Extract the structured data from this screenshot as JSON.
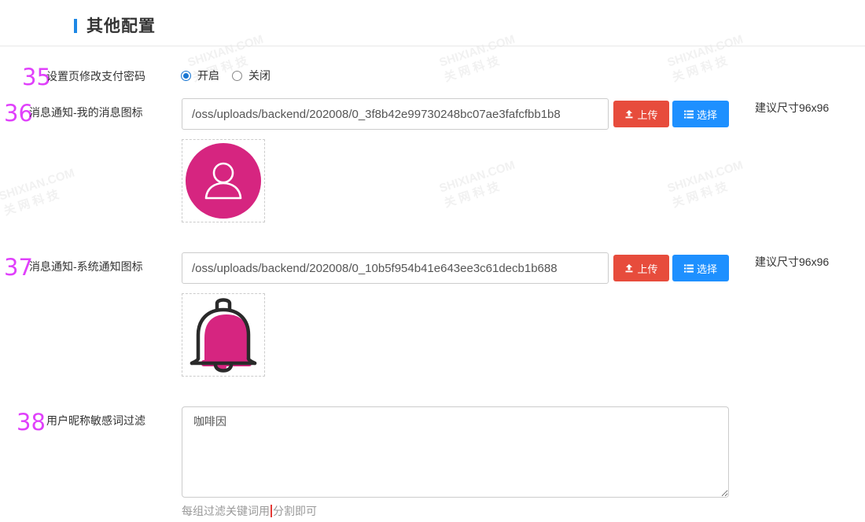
{
  "section": {
    "title": "其他配置"
  },
  "rows": [
    {
      "num": "35",
      "label": "设置页修改支付密码"
    },
    {
      "num": "36",
      "label": "消息通知-我的消息图标"
    },
    {
      "num": "37",
      "label": "消息通知-系统通知图标"
    },
    {
      "num": "38",
      "label": "用户昵称敏感词过滤"
    }
  ],
  "pay_password": {
    "options": [
      {
        "label": "开启",
        "checked": true
      },
      {
        "label": "关闭",
        "checked": false
      }
    ]
  },
  "my_message_icon": {
    "path": "/oss/uploads/backend/202008/0_3f8b42e99730248bc07ae3fafcfbb1b8",
    "hint": "建议尺寸96x96",
    "icon": "user-avatar-icon",
    "color": "#d62580"
  },
  "system_notify_icon": {
    "path": "/oss/uploads/backend/202008/0_10b5f954b41e643ee3c61decb1b688",
    "hint": "建议尺寸96x96",
    "icon": "bell-icon",
    "color": "#d62580"
  },
  "buttons": {
    "upload": "上传",
    "select": "选择"
  },
  "sensitive_words": {
    "value": "咖啡因",
    "help_before": "每组过滤关键词用",
    "help_after": "分割即可"
  },
  "colors": {
    "accent": "#1e88e5",
    "upload_btn": "#e74c3c",
    "select_btn": "#1e90ff",
    "row_number": "#e040fb"
  }
}
